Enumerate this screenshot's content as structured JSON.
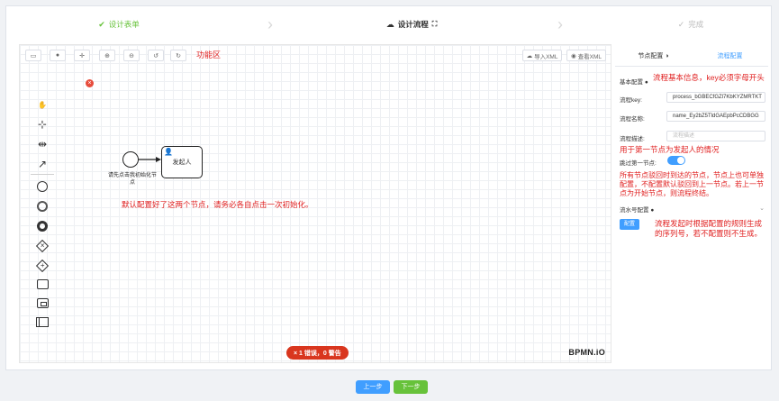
{
  "steps": {
    "step1": "设计表单",
    "step2": "设计流程",
    "step3": "完成"
  },
  "toolbar": {
    "import_xml": "导入XML",
    "view_xml": "查看XML",
    "annotation": "功能区"
  },
  "diagram": {
    "start_label": "请先点击我初始化节点",
    "task_label": "发起人",
    "error_badge": "× 1 错误，0 警告",
    "logo": "BPMN.iO"
  },
  "notes": {
    "init_hint": "默认配置好了这两个节点，请务必各自点击一次初始化。",
    "basic_info": "流程基本信息，key必须字母开头",
    "skip_first": "用于第一节点为发起人的情况",
    "reject_nodes": "所有节点驳回时到达的节点，节点上也可单独配置，不配置默认驳回到上一节点。若上一节点为开始节点，则流程终结。",
    "serial": "流程发起时根据配置的规则生成的序列号，若不配置则不生成。"
  },
  "panel": {
    "tab_node": "节点配置",
    "tab_flow": "流程配置",
    "basic_section": "基本配置",
    "key_label": "流程key:",
    "key_value": "process_bGBECfGZl7KbKYZMRTKT",
    "name_label": "流程名称:",
    "name_value": "name_Ey2bZ5TldGAEpbPcCDBGG",
    "desc_label": "流程描述:",
    "desc_placeholder": "流程描述",
    "skip_label": "跳过第一节点:",
    "skip_enabled": true,
    "serial_section": "流水号配置",
    "config_button": "配置"
  },
  "footer": {
    "prev": "上一步",
    "next": "下一步"
  },
  "colors": {
    "primary": "#409eff",
    "success": "#67c23a",
    "error": "#d9361e",
    "annotation": "#e02020"
  }
}
